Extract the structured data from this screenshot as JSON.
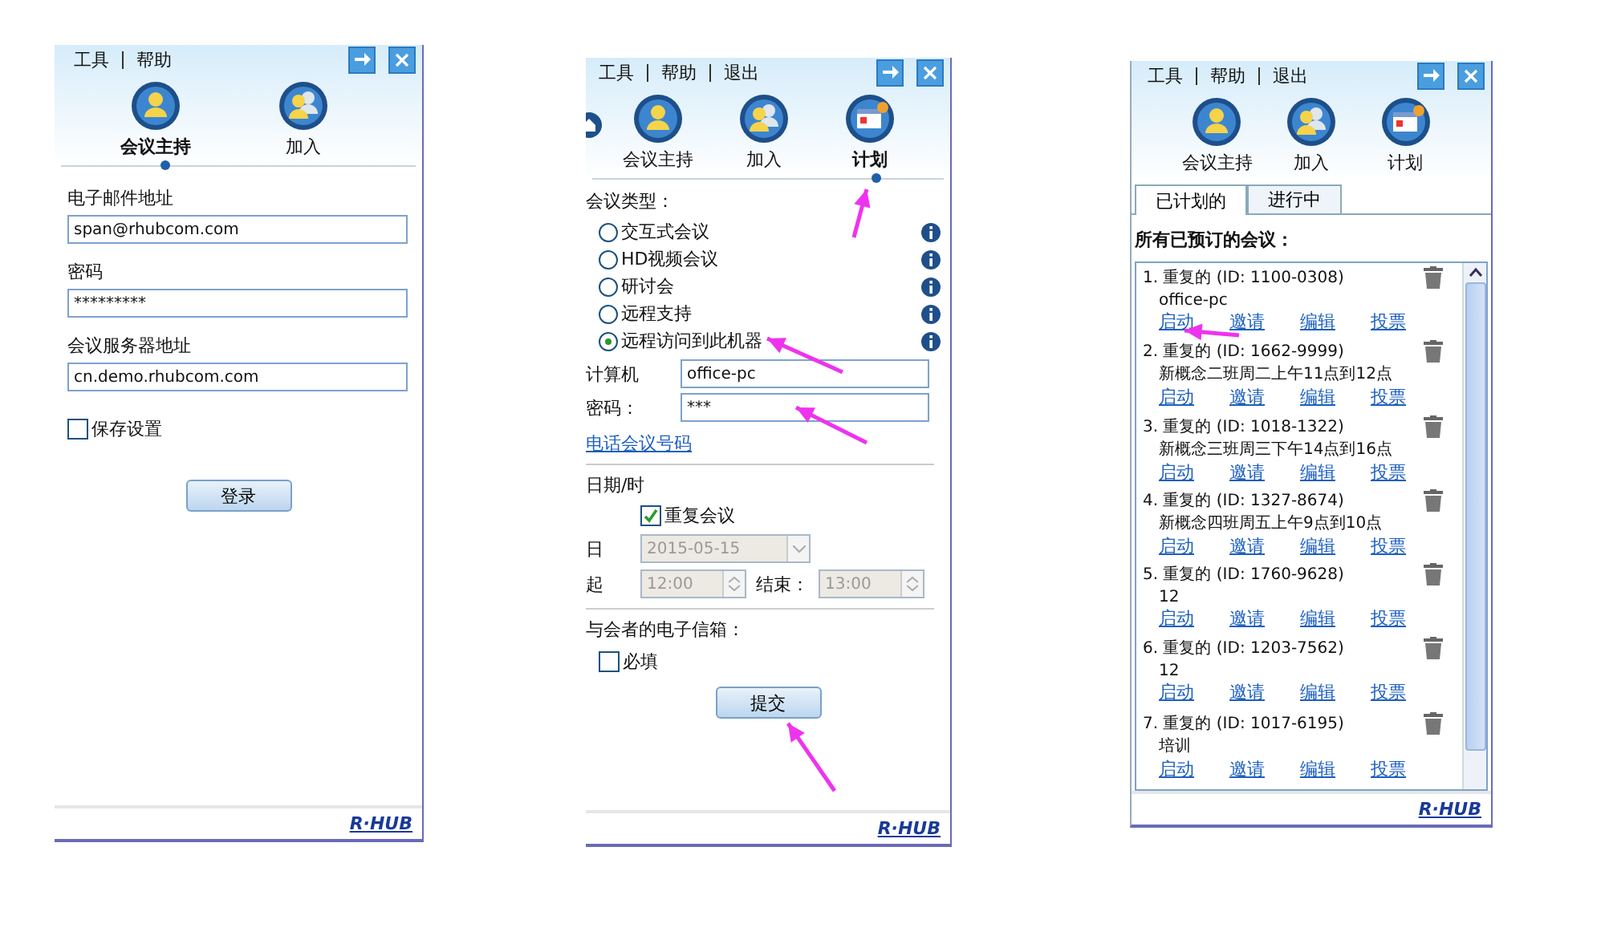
{
  "panels": [
    {
      "kind": "login",
      "menu": [
        "工具",
        "帮助"
      ],
      "nav": [
        {
          "label": "会议主持",
          "selected": true
        },
        {
          "label": "加入",
          "selected": false
        }
      ],
      "fields": [
        {
          "label": "电子邮件地址",
          "value": "span@rhubcom.com"
        },
        {
          "label": "密码",
          "value": "*********"
        },
        {
          "label": "会议服务器地址",
          "value": "cn.demo.rhubcom.com"
        }
      ],
      "save": {
        "label": "保存设置",
        "checked": false
      },
      "button": "登录",
      "logo": "R·HUB"
    },
    {
      "kind": "schedule",
      "menu": [
        "工具",
        "帮助",
        "退出"
      ],
      "nav": [
        {
          "label": "会议主持",
          "selected": false
        },
        {
          "label": "加入",
          "selected": false
        },
        {
          "label": "计划",
          "selected": true
        }
      ],
      "type_label": "会议类型：",
      "types": [
        {
          "label": "交互式会议",
          "selected": false
        },
        {
          "label": "HD视频会议",
          "selected": false
        },
        {
          "label": "研讨会",
          "selected": false
        },
        {
          "label": "远程支持",
          "selected": false
        },
        {
          "label": "远程访问到此机器",
          "selected": true
        }
      ],
      "fields": [
        {
          "label": "计算机",
          "value": "office-pc"
        },
        {
          "label": "密码：",
          "value": "***"
        }
      ],
      "link": "电话会议号码",
      "date_label": "日期/时",
      "repeat": {
        "label": "重复会议",
        "checked": true
      },
      "date": {
        "label": "日",
        "value": "2015-05-15",
        "disabled": true
      },
      "start": {
        "label": "起",
        "value": "12:00",
        "disabled": true
      },
      "end": {
        "label": "结束：",
        "value": "13:00",
        "disabled": true
      },
      "email_label": "与会者的电子信箱：",
      "required": {
        "label": "必填",
        "checked": false
      },
      "button": "提交",
      "logo": "R·HUB"
    },
    {
      "kind": "list",
      "menu": [
        "工具",
        "帮助",
        "退出"
      ],
      "nav": [
        {
          "label": "会议主持",
          "selected": false
        },
        {
          "label": "加入",
          "selected": false
        },
        {
          "label": "计划",
          "selected": false
        }
      ],
      "tabs": [
        {
          "label": "已计划的",
          "selected": true
        },
        {
          "label": "进行中",
          "selected": false
        }
      ],
      "heading": "所有已预订的会议：",
      "meetings": [
        {
          "title": "1. 重复的 (ID: 1100-0308)",
          "note": "office-pc",
          "actions": [
            "启动",
            "邀请",
            "编辑",
            "投票"
          ]
        },
        {
          "title": "2. 重复的 (ID: 1662-9999)",
          "note": "新概念二班周二上午11点到12点",
          "actions": [
            "启动",
            "邀请",
            "编辑",
            "投票"
          ]
        },
        {
          "title": "3. 重复的 (ID: 1018-1322)",
          "note": "新概念三班周三下午14点到16点",
          "actions": [
            "启动",
            "邀请",
            "编辑",
            "投票"
          ]
        },
        {
          "title": "4. 重复的 (ID: 1327-8674)",
          "note": "新概念四班周五上午9点到10点",
          "actions": [
            "启动",
            "邀请",
            "编辑",
            "投票"
          ]
        },
        {
          "title": "5. 重复的 (ID: 1760-9628)",
          "note": "12",
          "actions": [
            "启动",
            "邀请",
            "编辑",
            "投票"
          ]
        },
        {
          "title": "6. 重复的 (ID: 1203-7562)",
          "note": "12",
          "actions": [
            "启动",
            "邀请",
            "编辑",
            "投票"
          ]
        },
        {
          "title": "7. 重复的 (ID: 1017-6195)",
          "note": "培训",
          "actions": [
            "启动",
            "邀请",
            "编辑",
            "投票"
          ]
        }
      ],
      "logo": "R·HUB"
    }
  ]
}
